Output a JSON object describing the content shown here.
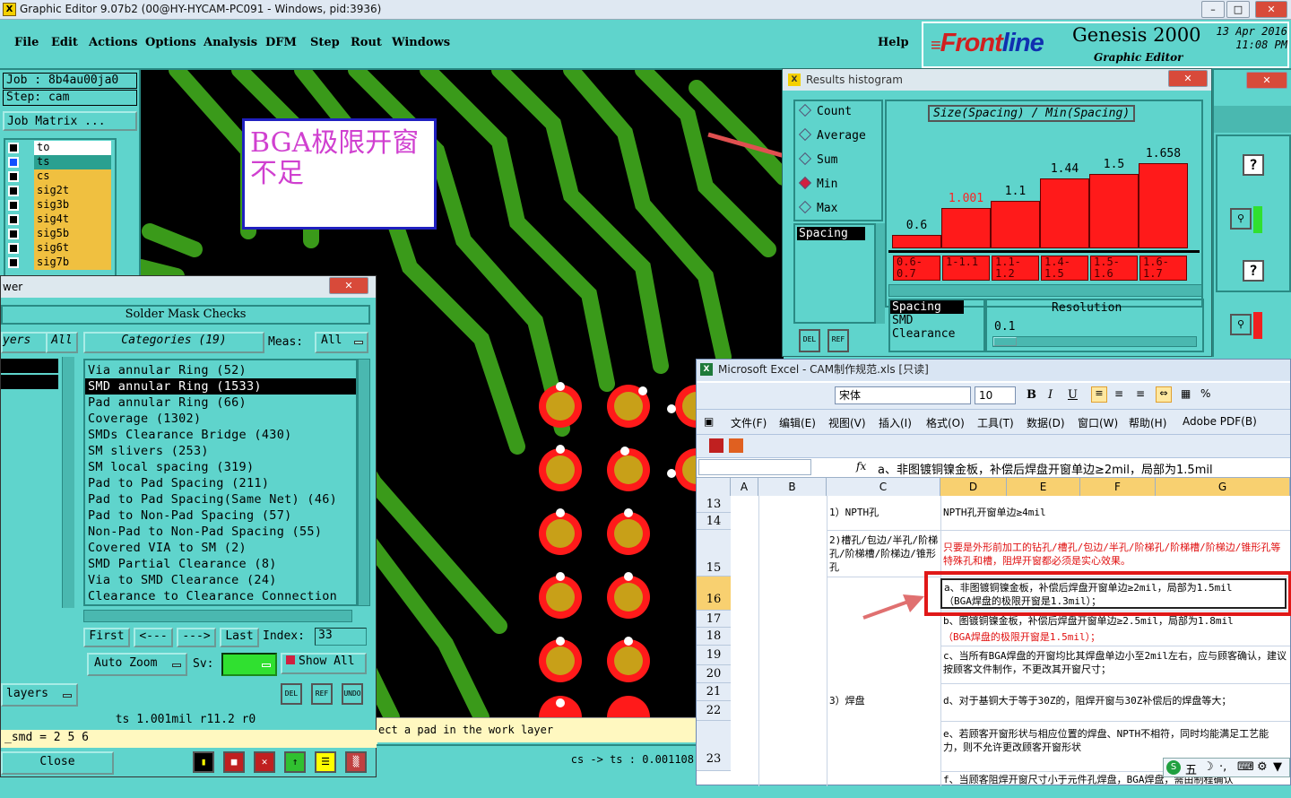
{
  "window": {
    "title": "Graphic Editor 9.07b2 (00@HY-HYCAM-PC091 - Windows, pid:3936)",
    "icon": "x-icon"
  },
  "menu": [
    {
      "label": "File",
      "u": "F"
    },
    {
      "label": "Edit",
      "u": "E"
    },
    {
      "label": "Actions",
      "u": "A"
    },
    {
      "label": "Options",
      "u": "O"
    },
    {
      "label": "Analysis",
      "u": "A"
    },
    {
      "label": "DFM",
      "u": "D"
    },
    {
      "label": "Step",
      "u": "S"
    },
    {
      "label": "Rout",
      "u": "R"
    },
    {
      "label": "Windows",
      "u": "W"
    }
  ],
  "help_label": "Help",
  "brand": {
    "logo_a": "Front",
    "logo_b": "line",
    "product": "Genesis 2000",
    "subtitle": "Graphic Editor",
    "date": "13 Apr 2016",
    "time": "11:08 PM"
  },
  "left_panel": {
    "job": "Job : 8b4au00ja0",
    "step": "Step: cam",
    "job_matrix": "Job Matrix ...",
    "layers": [
      "to",
      "ts",
      "cs",
      "sig2t",
      "sig3b",
      "sig4t",
      "sig5b",
      "sig6t",
      "sig7b"
    ]
  },
  "canvas_note": "BGA极限开窗不足",
  "solder_mask": {
    "window_title": "wer",
    "header": "Solder Mask Checks",
    "layers_label": "yers",
    "all_label": "All",
    "categories_label": "Categories (19)",
    "meas_label": "Meas:",
    "meas_value": "All",
    "items": [
      "Via annular Ring (52)",
      "SMD annular Ring (1533)",
      "Pad annular Ring (66)",
      "Coverage (1302)",
      "SMDs Clearance Bridge (430)",
      "SM slivers (253)",
      "SM local spacing (319)",
      "Pad to Pad Spacing (211)",
      "Pad to Pad Spacing(Same Net) (46)",
      "Pad to Non-Pad Spacing (57)",
      "Non-Pad to Non-Pad Spacing (55)",
      "Covered VIA to SM (2)",
      "SMD Partial Clearance (8)",
      "Via to SMD Clearance (24)",
      "Clearance to Clearance Connection"
    ],
    "selected_index": 1,
    "nav": {
      "first": "First",
      "prev": "<---",
      "next": "--->",
      "last": "Last",
      "index_label": "Index:",
      "index_value": "33"
    },
    "auto_zoom": "Auto Zoom",
    "sv_label": "Sv:",
    "show_all": "Show All",
    "layers_btn": "layers",
    "status1": "ts 1.001mil  r11.2  r0",
    "status2": "_smd = 2 5 6",
    "close": "Close",
    "del": "DEL",
    "ref": "REF",
    "undo": "UNDO"
  },
  "prompt": "ect a pad in the work layer",
  "coord": "cs -> ts : 0.001108",
  "histogram": {
    "title": "Results histogram",
    "modes": [
      "Count",
      "Average",
      "Sum",
      "Min",
      "Max"
    ],
    "selected_mode": "Min",
    "heading": "Size(Spacing) / Min(Spacing)",
    "list": [
      "Spacing"
    ],
    "del": "DEL",
    "ref": "REF",
    "bottom_list": [
      "Spacing",
      "SMD",
      "Clearance"
    ],
    "resolution_label": "Resolution",
    "resolution_value": "0.1"
  },
  "chart_data": {
    "type": "bar",
    "title": "Size(Spacing) / Min(Spacing)",
    "categories": [
      "0.6-0.7",
      "1-1.1",
      "1.1-1.2",
      "1.4-1.5",
      "1.5-1.6",
      "1.6-1.7"
    ],
    "values": [
      0.6,
      1.001,
      1.1,
      1.44,
      1.5,
      1.658
    ],
    "labels": [
      "0.6",
      "1.001",
      "1.1",
      "1.44",
      "1.5",
      "1.658"
    ],
    "highlight_index": 1,
    "bar_color": "#ff1a1a"
  },
  "excel": {
    "title": "Microsoft Excel - CAM制作规范.xls [只读]",
    "font": "宋体",
    "size": "10",
    "menus": [
      "文件(F)",
      "编辑(E)",
      "视图(V)",
      "插入(I)",
      "格式(O)",
      "工具(T)",
      "数据(D)",
      "窗口(W)",
      "帮助(H)",
      "Adobe PDF(B)"
    ],
    "fx": "fx",
    "formula": "a、非图镀铜镍金板，补偿后焊盘开窗单边≥2mil，局部为1.5mil",
    "columns": [
      "A",
      "B",
      "C",
      "D",
      "E",
      "F",
      "G"
    ],
    "rows": [
      "13",
      "14",
      "15",
      "16",
      "17",
      "18",
      "19",
      "20",
      "21",
      "22",
      "23"
    ],
    "c_npth": "1）NPTH孔",
    "d_npth": "NPTH孔开窗单边≥4mil",
    "c_slot": "2)槽孔/包边/半孔/阶梯孔/阶梯槽/阶梯边/锥形孔",
    "d_slot": "只要是外形前加工的钻孔/槽孔/包边/半孔/阶梯孔/阶梯槽/阶梯边/锥形孔等特殊孔和槽，阻焊开窗都必须是实心效果。",
    "d_a1": "a、非图镀铜镍金板，补偿后焊盘开窗单边≥2mil，局部为1.5mil",
    "d_a2": "（BGA焊盘的极限开窗是1.3mil）；",
    "d_b1": "b、图镀铜镍金板，补偿后焊盘开窗单边≥2.5mil，局部为1.8mil",
    "d_b2": "（BGA焊盘的极限开窗是1.5mil）；",
    "d_c": "c、当所有BGA焊盘的开窗均比其焊盘单边小至2mil左右，应与顾客确认，建议按顾客文件制作，不更改其开窗尺寸；",
    "c_pad": "3）焊盘",
    "d_d": "d、对于基铜大于等于30Z的，阻焊开窗与30Z补偿后的焊盘等大；",
    "d_e": "e、若顾客开窗形状与相应位置的焊盘、NPTH不相符，同时均能满足工艺能力，则不允许更改顾客开窗形状",
    "d_f": "f、当顾客阻焊开窗尺寸小于元件孔焊盘，BGA焊盘，需由制程确认",
    "ime": "五"
  }
}
